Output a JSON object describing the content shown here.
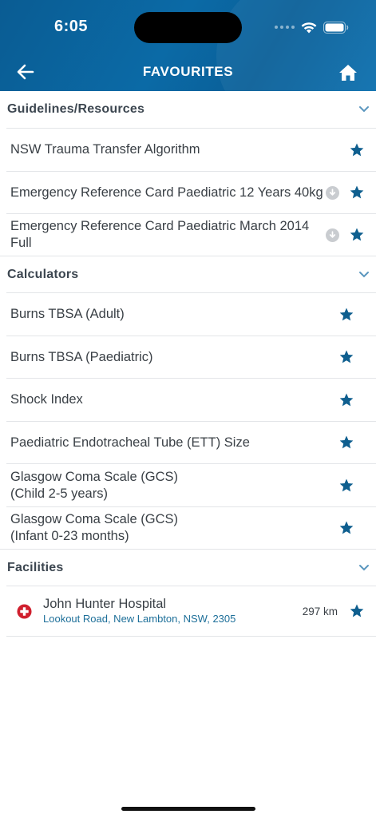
{
  "status_bar": {
    "time": "6:05"
  },
  "nav": {
    "title": "FAVOURITES"
  },
  "sections": {
    "guidelines": {
      "title": "Guidelines/Resources",
      "items": [
        {
          "label": "NSW Trauma Transfer Algorithm"
        },
        {
          "label": "Emergency Reference Card Paediatric 12 Years 40kg"
        },
        {
          "label": "Emergency Reference Card Paediatric March 2014 Full"
        }
      ]
    },
    "calculators": {
      "title": "Calculators",
      "items": [
        {
          "label": "Burns TBSA (Adult)"
        },
        {
          "label": "Burns TBSA (Paediatric)"
        },
        {
          "label": "Shock Index"
        },
        {
          "label": "Paediatric Endotracheal Tube (ETT) Size"
        },
        {
          "label": "Glasgow Coma Scale (GCS)\n(Child 2-5 years)"
        },
        {
          "label": "Glasgow Coma Scale (GCS)\n(Infant 0-23 months)"
        }
      ]
    },
    "facilities": {
      "title": "Facilities",
      "items": [
        {
          "name": "John Hunter Hospital",
          "address": "Lookout Road, New Lambton, NSW, 2305",
          "distance": "297 km"
        }
      ]
    }
  },
  "colors": {
    "header": "#0b6aa6",
    "star": "#0f5f8f",
    "link": "#1d6f99",
    "hospital": "#d0202e"
  },
  "icons": [
    "back-arrow-icon",
    "home-icon",
    "chevron-down-icon",
    "star-icon",
    "download-icon",
    "hospital-cross-icon",
    "wifi-icon",
    "battery-icon"
  ]
}
